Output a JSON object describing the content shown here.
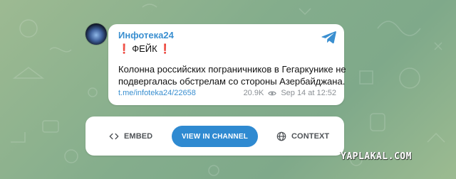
{
  "post": {
    "channel_name": "Инфотека24",
    "headline": "ФЕЙК",
    "headline_marker": "❗",
    "body_lines": [
      "Колонна российских пограничников в Гегаркунике не",
      "подвергалась обстрелам со стороны Азербайджана."
    ],
    "link": "t.me/infoteka24/22658",
    "views": "20.9K",
    "date": "Sep 14 at 12:52"
  },
  "actions": {
    "embed_label": "EMBED",
    "view_label": "VIEW IN CHANNEL",
    "context_label": "CONTEXT"
  },
  "watermark": "YAPLAKAL.COM",
  "colors": {
    "accent": "#3a8fd0",
    "button": "#2f8ad1",
    "marker": "#e1231f",
    "background": "#8fb28d"
  },
  "icons": [
    "telegram-icon",
    "exclamation-icon",
    "eye-icon",
    "code-icon",
    "globe-icon"
  ]
}
